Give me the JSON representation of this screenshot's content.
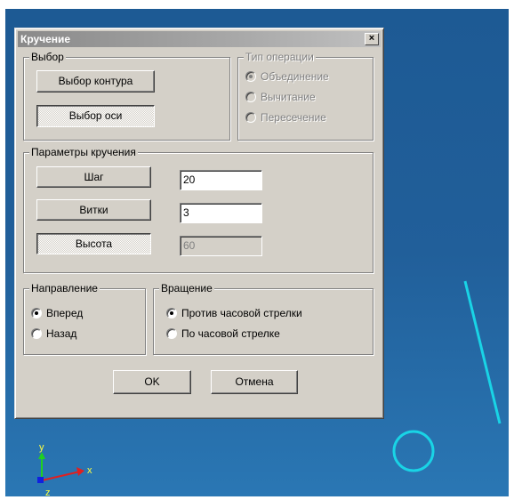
{
  "dialog": {
    "title": "Кручение",
    "close_label": "×",
    "selection": {
      "legend": "Выбор",
      "contour_button": "Выбор контура",
      "axis_button": "Выбор оси"
    },
    "operation": {
      "legend": "Тип операции",
      "options": [
        "Объединение",
        "Вычитание",
        "Пересечение"
      ],
      "selected": "Объединение"
    },
    "params": {
      "legend": "Параметры кручения",
      "step_label": "Шаг",
      "step_value": "20",
      "turns_label": "Витки",
      "turns_value": "3",
      "height_label": "Высота",
      "height_value": "60"
    },
    "direction": {
      "legend": "Направление",
      "options": [
        "Вперед",
        "Назад"
      ],
      "selected": "Вперед"
    },
    "rotation": {
      "legend": "Вращение",
      "options": [
        "Против часовой стрелки",
        "По часовой стрелке"
      ],
      "selected": "Против часовой стрелки"
    },
    "ok_label": "OK",
    "cancel_label": "Отмена"
  },
  "axes": {
    "x": "x",
    "y": "y",
    "z": "z"
  },
  "colors": {
    "viewport_top": "#1d5a94",
    "viewport_bottom": "#2a77b4",
    "sketch": "#19d4e6",
    "axis_x": "#e02020",
    "axis_y": "#20d020",
    "axis_z": "#1020e0"
  }
}
